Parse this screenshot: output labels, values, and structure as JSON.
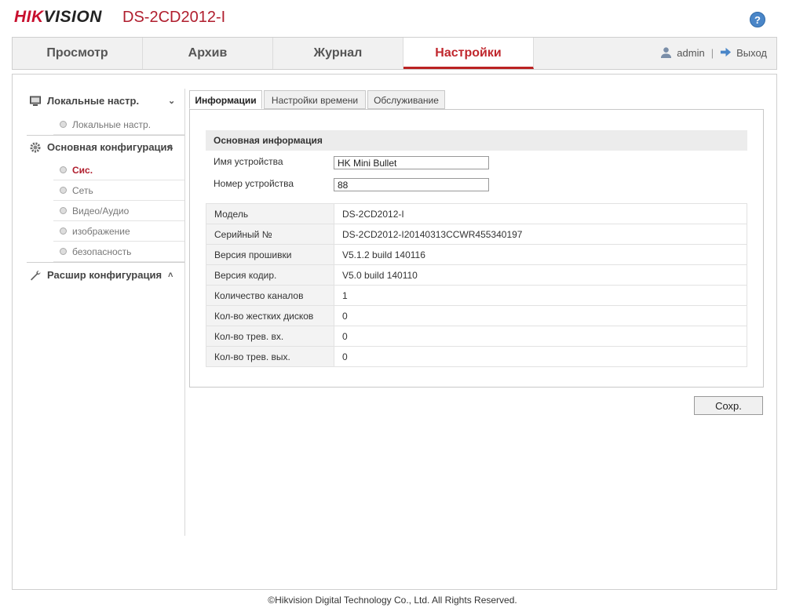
{
  "header": {
    "logo_brand": "HIK",
    "logo_rest": "VISION",
    "device_model": "DS-2CD2012-I",
    "help_icon": "question-mark-icon"
  },
  "nav": {
    "tabs": [
      {
        "label": "Просмотр"
      },
      {
        "label": "Архив"
      },
      {
        "label": "Журнал"
      },
      {
        "label": "Настройки"
      }
    ],
    "active_tab": "Настройки",
    "user": "admin",
    "logout": "Выход"
  },
  "sidebar": {
    "groups": [
      {
        "label": "Локальные настр.",
        "icon": "monitor-icon",
        "items": [
          {
            "label": "Локальные настр."
          }
        ]
      },
      {
        "label": "Основная конфигурация",
        "icon": "gear-icon",
        "items": [
          {
            "label": "Сис."
          },
          {
            "label": "Сеть"
          },
          {
            "label": "Видео/Аудио"
          },
          {
            "label": "изображение"
          },
          {
            "label": "безопасность"
          }
        ]
      },
      {
        "label": "Расшир конфигурация",
        "icon": "wrench-icon",
        "items": []
      }
    ],
    "active_item": "Сис."
  },
  "subtabs": [
    {
      "label": "Информации"
    },
    {
      "label": "Настройки времени"
    },
    {
      "label": "Обслуживание"
    }
  ],
  "section": {
    "title": "Основная информация",
    "device_name_label": "Имя устройства",
    "device_name_value": "HK Mini Bullet",
    "device_no_label": "Номер устройства",
    "device_no_value": "88"
  },
  "info_rows": [
    {
      "key": "Модель",
      "value": "DS-2CD2012-I"
    },
    {
      "key": "Серийный №",
      "value": "DS-2CD2012-I20140313CCWR455340197"
    },
    {
      "key": "Версия прошивки",
      "value": "V5.1.2 build 140116"
    },
    {
      "key": "Версия кодир.",
      "value": "V5.0 build 140110"
    },
    {
      "key": "Количество каналов",
      "value": "1"
    },
    {
      "key": "Кол-во жестких дисков",
      "value": "0"
    },
    {
      "key": "Кол-во трев. вх.",
      "value": "0"
    },
    {
      "key": "Кол-во трев. вых.",
      "value": "0"
    }
  ],
  "save_label": "Сохр.",
  "footer": "©Hikvision Digital Technology Co., Ltd. All Rights Reserved."
}
